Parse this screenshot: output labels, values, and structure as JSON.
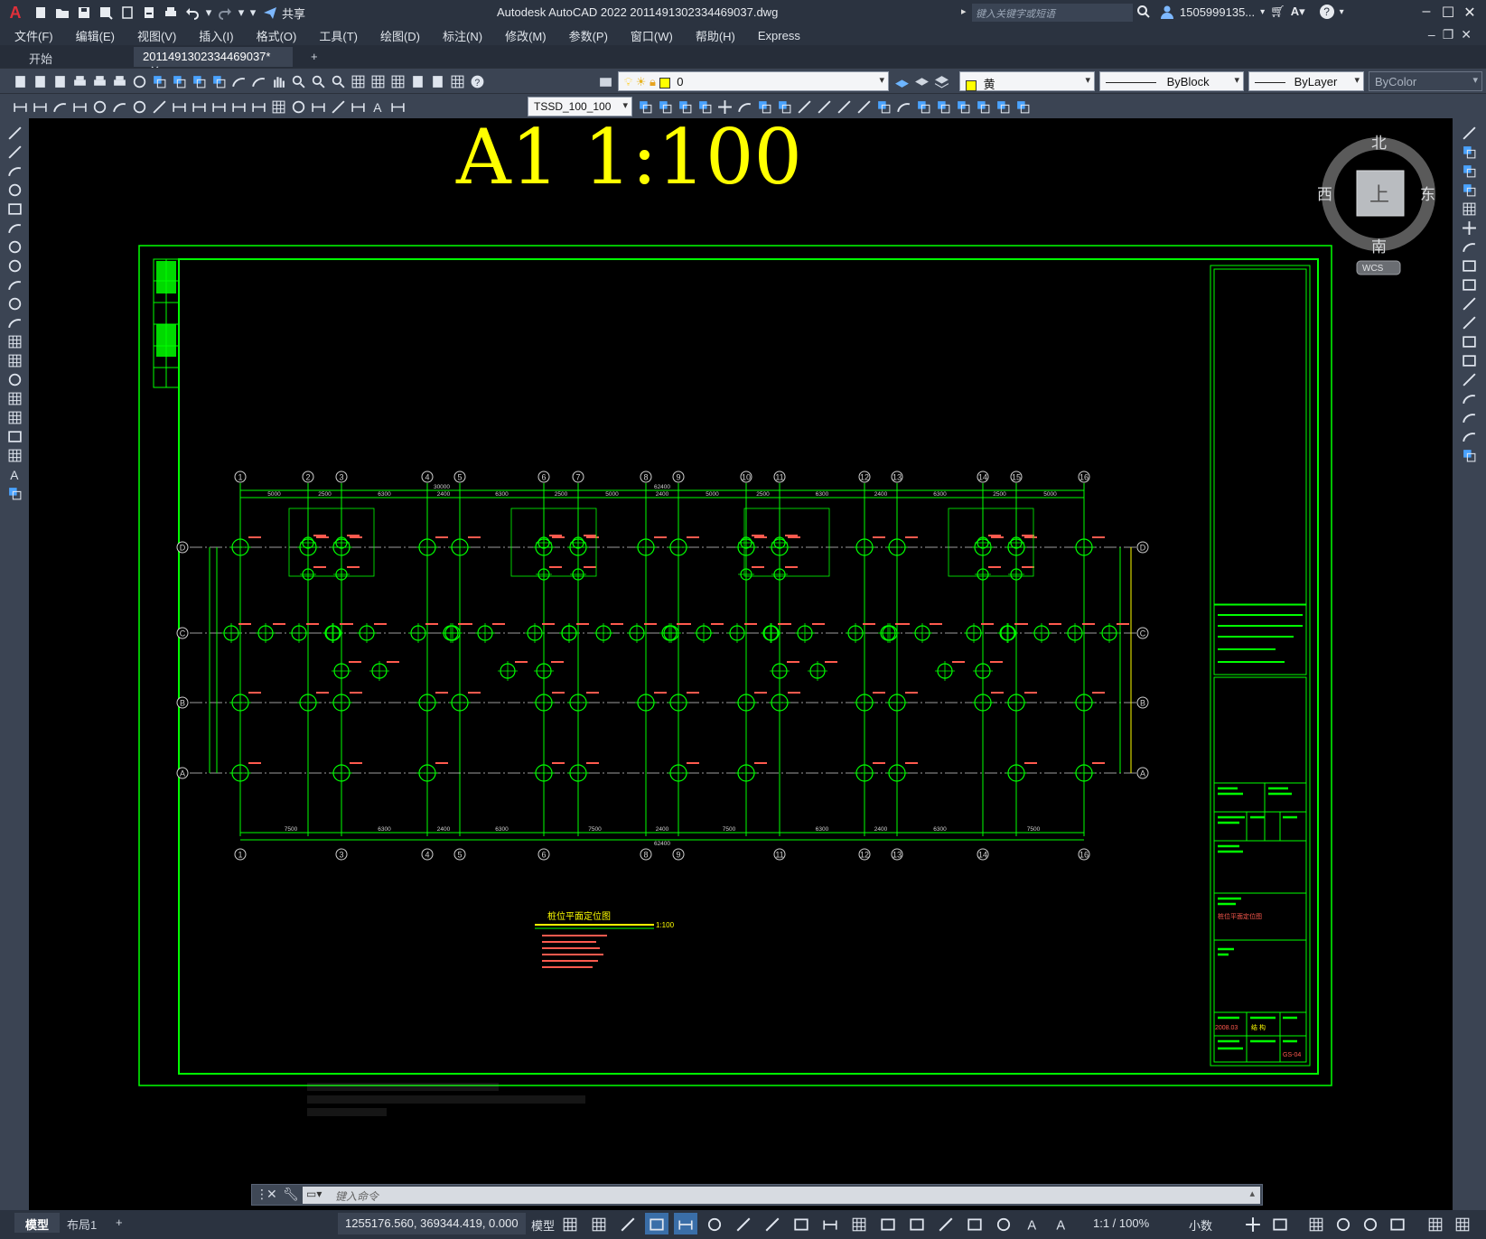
{
  "app": {
    "logo": "A",
    "title": "Autodesk AutoCAD 2022    2011491302334469037.dwg",
    "search_placeholder": "键入关键字或短语",
    "share_label": "共享",
    "user": "1505999135...",
    "cart_icon": "cart-icon",
    "help": "?"
  },
  "menu": [
    "文件(F)",
    "编辑(E)",
    "视图(V)",
    "插入(I)",
    "格式(O)",
    "工具(T)",
    "绘图(D)",
    "标注(N)",
    "修改(M)",
    "参数(P)",
    "窗口(W)",
    "帮助(H)",
    "Express"
  ],
  "tabs": {
    "start": "开始",
    "doc": "2011491302334469037*",
    "close": "✕",
    "add": "+"
  },
  "toolbar": {
    "layer_value": "0",
    "color_value": "黄",
    "linetype_value": "ByBlock",
    "lineweight_value": "ByLayer",
    "plotstyle_value": "ByColor",
    "dimstyle_value": "TSSD_100_100"
  },
  "viewcube": {
    "north": "北",
    "south": "南",
    "east": "东",
    "west": "西",
    "top": "上",
    "wcs": "WCS"
  },
  "drawing": {
    "sheet_label": "A1  1:100",
    "plan_title": "桩位平面定位图",
    "plan_scale": "1:100",
    "top_axes": [
      "1",
      "2",
      "3",
      "4",
      "5",
      "6",
      "7",
      "8",
      "9",
      "10",
      "11",
      "12",
      "13",
      "14",
      "15",
      "16"
    ],
    "bottom_axes": [
      "1",
      "3",
      "4",
      "5",
      "6",
      "8",
      "9",
      "11",
      "12",
      "13",
      "14",
      "16"
    ],
    "row_axes": [
      "D",
      "C",
      "B",
      "A"
    ],
    "total_width": "62400",
    "sub_span": "30000",
    "top_dims": [
      "5000",
      "2500",
      "6300",
      "2400",
      "6300",
      "2500",
      "5000",
      "2400",
      "5000",
      "2500",
      "6300",
      "2400",
      "6300",
      "2500",
      "5000"
    ],
    "bottom_dims": [
      "7500",
      "6300",
      "2400",
      "6300",
      "7500",
      "2400",
      "7500",
      "6300",
      "2400",
      "6300",
      "7500"
    ],
    "titleblock_date": "2008.03",
    "titleblock_sheet": "GS-04",
    "titleblock_drawing_name": "桩位平面定位图",
    "titleblock_spec": "结  构"
  },
  "command": {
    "placeholder": "键入命令"
  },
  "status": {
    "model_tab": "模型",
    "layout_tab": "布局1",
    "coords": "1255176.560, 369344.419, 0.000",
    "space": "模型",
    "scale": "1:1 / 100%",
    "units": "小数"
  },
  "colors": {
    "accent_green": "#00ff00",
    "drawing_yellow": "#ffff00",
    "dimension_red": "#ff5a4e",
    "canvas_bg": "#000000",
    "ui_bg": "#3b4453"
  }
}
